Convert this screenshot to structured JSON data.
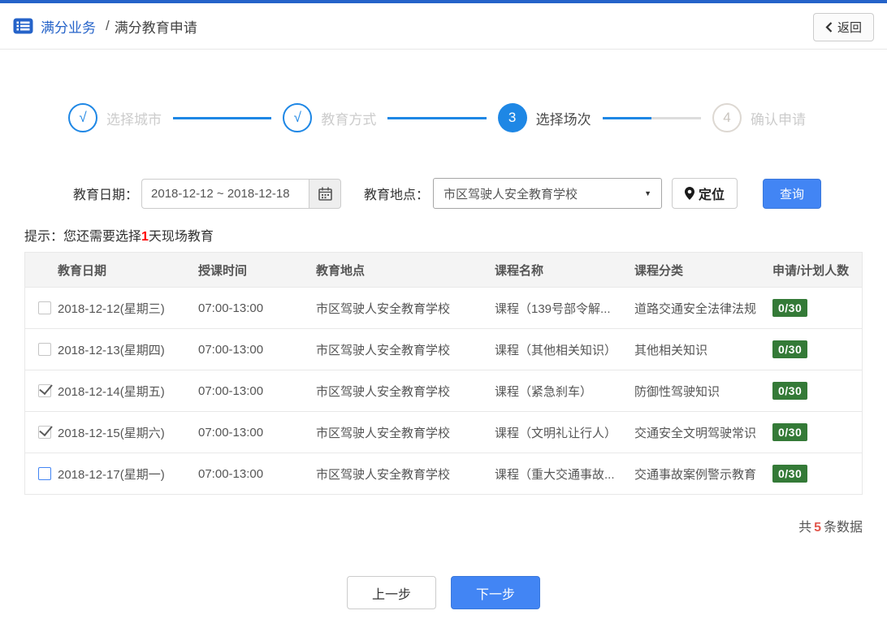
{
  "header": {
    "breadcrumb_root": "满分业务",
    "breadcrumb_sep": "/",
    "breadcrumb_current": "满分教育申请",
    "back_label": "返回"
  },
  "steps": [
    {
      "num": "√",
      "label": "选择城市",
      "state": "done"
    },
    {
      "num": "√",
      "label": "教育方式",
      "state": "done"
    },
    {
      "num": "3",
      "label": "选择场次",
      "state": "active"
    },
    {
      "num": "4",
      "label": "确认申请",
      "state": "pending"
    }
  ],
  "filters": {
    "date_label": "教育日期：",
    "date_value": "2018-12-12 ~ 2018-12-18",
    "location_label": "教育地点：",
    "location_value": "市区驾驶人安全教育学校",
    "locate_button": "定位",
    "query_button": "查询"
  },
  "hint": {
    "prefix": "提示：您还需要选择",
    "highlight": "1",
    "suffix": "天现场教育"
  },
  "table": {
    "headers": [
      "教育日期",
      "授课时间",
      "教育地点",
      "课程名称",
      "课程分类",
      "申请/计划人数"
    ],
    "rows": [
      {
        "checkbox": "unchecked",
        "date": "2018-12-12(星期三)",
        "time": "07:00-13:00",
        "location": "市区驾驶人安全教育学校",
        "course": "课程（139号部令解...",
        "category": "道路交通安全法律法规",
        "count": "0/30"
      },
      {
        "checkbox": "unchecked",
        "date": "2018-12-13(星期四)",
        "time": "07:00-13:00",
        "location": "市区驾驶人安全教育学校",
        "course": "课程（其他相关知识）",
        "category": "其他相关知识",
        "count": "0/30"
      },
      {
        "checkbox": "checked",
        "date": "2018-12-14(星期五)",
        "time": "07:00-13:00",
        "location": "市区驾驶人安全教育学校",
        "course": "课程（紧急刹车）",
        "category": "防御性驾驶知识",
        "count": "0/30"
      },
      {
        "checkbox": "checked",
        "date": "2018-12-15(星期六)",
        "time": "07:00-13:00",
        "location": "市区驾驶人安全教育学校",
        "course": "课程（文明礼让行人）",
        "category": "交通安全文明驾驶常识",
        "count": "0/30"
      },
      {
        "checkbox": "unchecked-active",
        "date": "2018-12-17(星期一)",
        "time": "07:00-13:00",
        "location": "市区驾驶人安全教育学校",
        "course": "课程（重大交通事故...",
        "category": "交通事故案例警示教育",
        "count": "0/30"
      }
    ]
  },
  "summary": {
    "prefix": "共",
    "count": "5",
    "suffix": "条数据"
  },
  "footer": {
    "prev_button": "上一步",
    "next_button": "下一步"
  },
  "colors": {
    "accent_blue": "#2563c9",
    "step_blue": "#1e87e5",
    "button_blue": "#4285f4",
    "badge_green": "#347a37",
    "alert_red": "#ff0000",
    "count_red": "#e2574d"
  }
}
